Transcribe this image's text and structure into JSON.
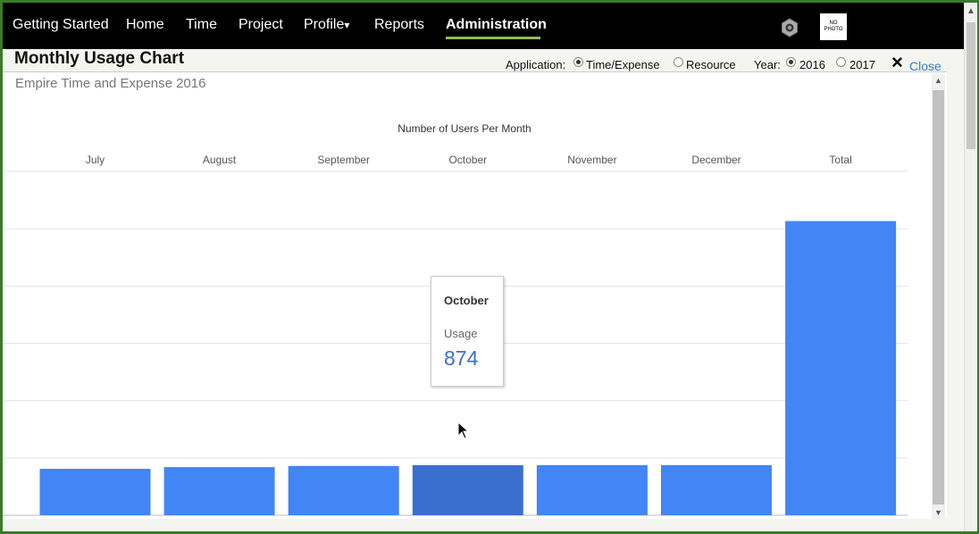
{
  "nav": {
    "items": [
      "Getting Started",
      "Home",
      "Time",
      "Project",
      "Profile",
      "Reports",
      "Administration"
    ],
    "active": "Administration",
    "profile_caret": "▾",
    "avatar_text": "NO PHOTO"
  },
  "header": {
    "title": "Monthly Usage Chart",
    "application_label": "Application:",
    "app_options": [
      "Time/Expense",
      "Resource"
    ],
    "app_selected": "Time/Expense",
    "year_label": "Year:",
    "year_options": [
      "2016",
      "2017"
    ],
    "year_selected": "2016",
    "close_label": "Close",
    "close_icon": "×"
  },
  "panel": {
    "subtitle": "Empire Time and Expense 2016"
  },
  "chart_data": {
    "type": "bar",
    "title": "Number of Users Per Month",
    "categories": [
      "July",
      "August",
      "September",
      "October",
      "November",
      "December",
      "Total"
    ],
    "values": [
      810,
      840,
      860,
      874,
      875,
      875,
      5134
    ],
    "ylim": [
      0,
      6000
    ],
    "grid": true,
    "legend": "none",
    "bar_color": "#4285f4",
    "highlight_color": "#3a6fd0",
    "highlight_index": 3
  },
  "tooltip": {
    "title": "October",
    "label": "Usage",
    "value": "874"
  }
}
